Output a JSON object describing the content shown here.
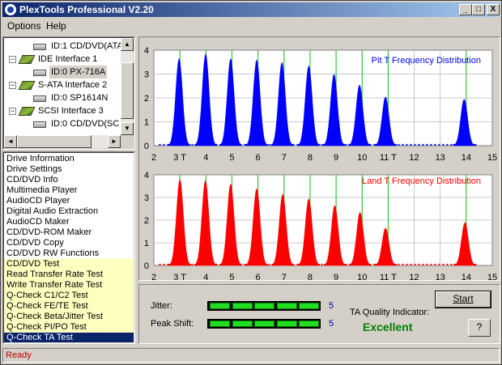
{
  "window": {
    "title": "PlexTools Professional V2.20",
    "controls": [
      "_",
      "□",
      "X"
    ]
  },
  "menu": {
    "options": "Options",
    "help": "Help"
  },
  "tree": [
    {
      "label": "ID:1  CD/DVD(ATA",
      "icon": "optical-drive-icon",
      "indent": 2,
      "expander": ""
    },
    {
      "label": "IDE Interface 1",
      "icon": "ide-interface-icon",
      "indent": 1,
      "expander": "−"
    },
    {
      "label": "ID:0  PX-716A",
      "icon": "optical-drive-icon",
      "indent": 2,
      "expander": "",
      "selected": true
    },
    {
      "label": "S-ATA Interface 2",
      "icon": "sata-interface-icon",
      "indent": 1,
      "expander": "−"
    },
    {
      "label": "ID:0  SP1614N",
      "icon": "hard-drive-icon",
      "indent": 2,
      "expander": ""
    },
    {
      "label": "SCSI Interface 3",
      "icon": "scsi-interface-icon",
      "indent": 1,
      "expander": "−"
    },
    {
      "label": "ID:0  CD/DVD(SC",
      "icon": "optical-drive-icon",
      "indent": 2,
      "expander": ""
    }
  ],
  "functions": [
    {
      "label": "Drive Information",
      "hl": false
    },
    {
      "label": "Drive Settings",
      "hl": false
    },
    {
      "label": "CD/DVD Info",
      "hl": false
    },
    {
      "label": "Multimedia Player",
      "hl": false
    },
    {
      "label": "AudioCD Player",
      "hl": false
    },
    {
      "label": "Digital Audio Extraction",
      "hl": false
    },
    {
      "label": "AudioCD Maker",
      "hl": false
    },
    {
      "label": "CD/DVD-ROM Maker",
      "hl": false
    },
    {
      "label": "CD/DVD Copy",
      "hl": false
    },
    {
      "label": "CD/DVD RW Functions",
      "hl": false
    },
    {
      "label": "CD/DVD Test",
      "hl": true
    },
    {
      "label": "Read Transfer Rate Test",
      "hl": true
    },
    {
      "label": "Write Transfer Rate Test",
      "hl": true
    },
    {
      "label": "Q-Check C1/C2 Test",
      "hl": true
    },
    {
      "label": "Q-Check FE/TE Test",
      "hl": true
    },
    {
      "label": "Q-Check Beta/Jitter Test",
      "hl": true
    },
    {
      "label": "Q-Check PI/PO Test",
      "hl": true
    },
    {
      "label": "Q-Check TA Test",
      "hl": true,
      "selected": true
    }
  ],
  "chart_data": [
    {
      "type": "area",
      "title": "Pit T Frequency Distribution",
      "color": "#0000ff",
      "xlim": [
        2,
        15
      ],
      "ylim": [
        0,
        4
      ],
      "x_ticks": [
        "2",
        "3 T",
        "4",
        "5",
        "6",
        "7",
        "8",
        "9",
        "10",
        "11 T",
        "12",
        "13",
        "14",
        "15"
      ],
      "y_ticks": [
        "0",
        "1",
        "2",
        "3",
        "4"
      ],
      "reference_lines_x": [
        3,
        4,
        5,
        6,
        7,
        8,
        9,
        10,
        11,
        14
      ],
      "peaks": [
        {
          "center": 2.97,
          "height": 3.65
        },
        {
          "center": 3.99,
          "height": 3.85
        },
        {
          "center": 4.95,
          "height": 3.65
        },
        {
          "center": 5.95,
          "height": 3.6
        },
        {
          "center": 6.92,
          "height": 3.5
        },
        {
          "center": 7.95,
          "height": 3.35
        },
        {
          "center": 8.92,
          "height": 3.0
        },
        {
          "center": 9.9,
          "height": 2.55
        },
        {
          "center": 10.9,
          "height": 2.05
        },
        {
          "center": 13.92,
          "height": 1.95
        }
      ]
    },
    {
      "type": "area",
      "title": "Land T Frequency Distribution",
      "color": "#ff0000",
      "xlim": [
        2,
        15
      ],
      "ylim": [
        0,
        4
      ],
      "x_ticks": [
        "2",
        "3 T",
        "4",
        "5",
        "6",
        "7",
        "8",
        "9",
        "10",
        "11 T",
        "12",
        "13",
        "14",
        "15"
      ],
      "y_ticks": [
        "0",
        "1",
        "2",
        "3",
        "4"
      ],
      "reference_lines_x": [
        3,
        4,
        5,
        6,
        7,
        8,
        9,
        10,
        11,
        14
      ],
      "peaks": [
        {
          "center": 3.0,
          "height": 3.8
        },
        {
          "center": 3.98,
          "height": 3.75
        },
        {
          "center": 4.95,
          "height": 3.6
        },
        {
          "center": 5.95,
          "height": 3.4
        },
        {
          "center": 6.95,
          "height": 3.15
        },
        {
          "center": 7.95,
          "height": 2.95
        },
        {
          "center": 8.95,
          "height": 2.65
        },
        {
          "center": 9.92,
          "height": 2.35
        },
        {
          "center": 10.9,
          "height": 1.65
        },
        {
          "center": 13.95,
          "height": 1.9
        }
      ]
    }
  ],
  "metrics": {
    "jitter_label": "Jitter:",
    "jitter_value": "5",
    "jitter_level": 5,
    "peakshift_label": "Peak Shift:",
    "peakshift_value": "5",
    "peakshift_level": 5,
    "max_level": 5
  },
  "quality": {
    "label": "TA Quality Indicator:",
    "value": "Excellent",
    "color": "#008000"
  },
  "buttons": {
    "start": "Start",
    "help": "?"
  },
  "status": {
    "text": "Ready"
  }
}
